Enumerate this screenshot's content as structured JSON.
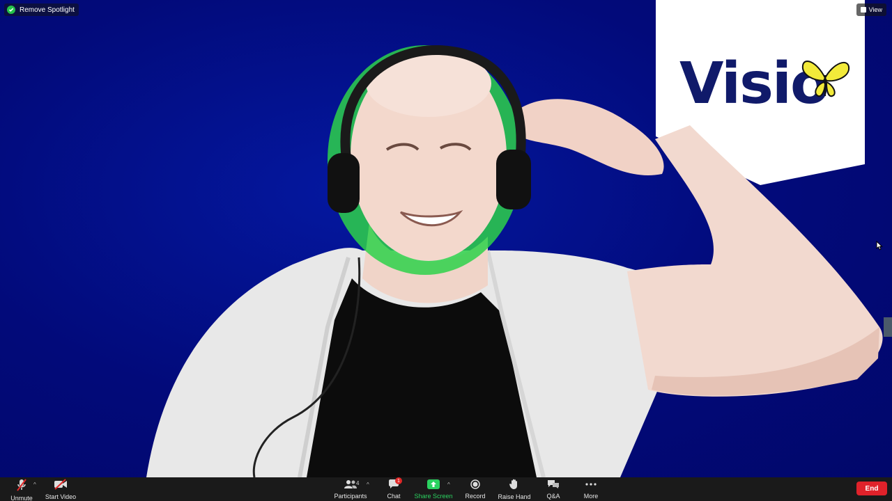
{
  "top_bar": {
    "spotlight_label": "Remove Spotlight",
    "view_label": "View"
  },
  "video": {
    "logo_text": "Visio",
    "background_color": "#020a7a"
  },
  "toolbar": {
    "items": [
      {
        "id": "unmute",
        "label": "Unmute",
        "icon": "mic-muted-icon"
      },
      {
        "id": "start-video",
        "label": "Start Video",
        "icon": "video-off-icon"
      },
      {
        "id": "participants",
        "label": "Participants",
        "icon": "participants-icon",
        "count": "4"
      },
      {
        "id": "chat",
        "label": "Chat",
        "icon": "chat-icon",
        "badge": "1"
      },
      {
        "id": "share-screen",
        "label": "Share Screen",
        "icon": "share-screen-icon"
      },
      {
        "id": "record",
        "label": "Record",
        "icon": "record-icon"
      },
      {
        "id": "raise-hand",
        "label": "Raise Hand",
        "icon": "hand-icon"
      },
      {
        "id": "qa",
        "label": "Q&A",
        "icon": "qa-icon"
      },
      {
        "id": "more",
        "label": "More",
        "icon": "more-icon"
      }
    ],
    "end_label": "End"
  },
  "colors": {
    "share_green": "#2bd160",
    "end_red": "#e0222a",
    "toolbar_bg": "#1a1a1a"
  }
}
